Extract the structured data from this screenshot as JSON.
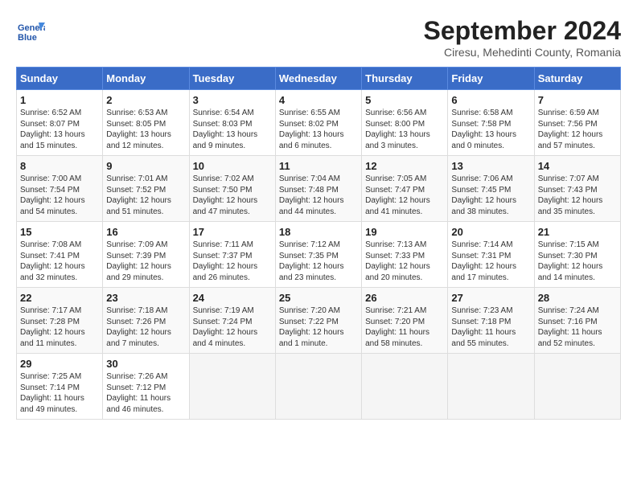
{
  "header": {
    "logo_line1": "General",
    "logo_line2": "Blue",
    "month": "September 2024",
    "location": "Ciresu, Mehedinti County, Romania"
  },
  "weekdays": [
    "Sunday",
    "Monday",
    "Tuesday",
    "Wednesday",
    "Thursday",
    "Friday",
    "Saturday"
  ],
  "weeks": [
    [
      {
        "day": "1",
        "rise": "6:52 AM",
        "set": "8:07 PM",
        "daylight": "13 hours and 15 minutes."
      },
      {
        "day": "2",
        "rise": "6:53 AM",
        "set": "8:05 PM",
        "daylight": "13 hours and 12 minutes."
      },
      {
        "day": "3",
        "rise": "6:54 AM",
        "set": "8:03 PM",
        "daylight": "13 hours and 9 minutes."
      },
      {
        "day": "4",
        "rise": "6:55 AM",
        "set": "8:02 PM",
        "daylight": "13 hours and 6 minutes."
      },
      {
        "day": "5",
        "rise": "6:56 AM",
        "set": "8:00 PM",
        "daylight": "13 hours and 3 minutes."
      },
      {
        "day": "6",
        "rise": "6:58 AM",
        "set": "7:58 PM",
        "daylight": "13 hours and 0 minutes."
      },
      {
        "day": "7",
        "rise": "6:59 AM",
        "set": "7:56 PM",
        "daylight": "12 hours and 57 minutes."
      }
    ],
    [
      {
        "day": "8",
        "rise": "7:00 AM",
        "set": "7:54 PM",
        "daylight": "12 hours and 54 minutes."
      },
      {
        "day": "9",
        "rise": "7:01 AM",
        "set": "7:52 PM",
        "daylight": "12 hours and 51 minutes."
      },
      {
        "day": "10",
        "rise": "7:02 AM",
        "set": "7:50 PM",
        "daylight": "12 hours and 47 minutes."
      },
      {
        "day": "11",
        "rise": "7:04 AM",
        "set": "7:48 PM",
        "daylight": "12 hours and 44 minutes."
      },
      {
        "day": "12",
        "rise": "7:05 AM",
        "set": "7:47 PM",
        "daylight": "12 hours and 41 minutes."
      },
      {
        "day": "13",
        "rise": "7:06 AM",
        "set": "7:45 PM",
        "daylight": "12 hours and 38 minutes."
      },
      {
        "day": "14",
        "rise": "7:07 AM",
        "set": "7:43 PM",
        "daylight": "12 hours and 35 minutes."
      }
    ],
    [
      {
        "day": "15",
        "rise": "7:08 AM",
        "set": "7:41 PM",
        "daylight": "12 hours and 32 minutes."
      },
      {
        "day": "16",
        "rise": "7:09 AM",
        "set": "7:39 PM",
        "daylight": "12 hours and 29 minutes."
      },
      {
        "day": "17",
        "rise": "7:11 AM",
        "set": "7:37 PM",
        "daylight": "12 hours and 26 minutes."
      },
      {
        "day": "18",
        "rise": "7:12 AM",
        "set": "7:35 PM",
        "daylight": "12 hours and 23 minutes."
      },
      {
        "day": "19",
        "rise": "7:13 AM",
        "set": "7:33 PM",
        "daylight": "12 hours and 20 minutes."
      },
      {
        "day": "20",
        "rise": "7:14 AM",
        "set": "7:31 PM",
        "daylight": "12 hours and 17 minutes."
      },
      {
        "day": "21",
        "rise": "7:15 AM",
        "set": "7:30 PM",
        "daylight": "12 hours and 14 minutes."
      }
    ],
    [
      {
        "day": "22",
        "rise": "7:17 AM",
        "set": "7:28 PM",
        "daylight": "12 hours and 11 minutes."
      },
      {
        "day": "23",
        "rise": "7:18 AM",
        "set": "7:26 PM",
        "daylight": "12 hours and 7 minutes."
      },
      {
        "day": "24",
        "rise": "7:19 AM",
        "set": "7:24 PM",
        "daylight": "12 hours and 4 minutes."
      },
      {
        "day": "25",
        "rise": "7:20 AM",
        "set": "7:22 PM",
        "daylight": "12 hours and 1 minute."
      },
      {
        "day": "26",
        "rise": "7:21 AM",
        "set": "7:20 PM",
        "daylight": "11 hours and 58 minutes."
      },
      {
        "day": "27",
        "rise": "7:23 AM",
        "set": "7:18 PM",
        "daylight": "11 hours and 55 minutes."
      },
      {
        "day": "28",
        "rise": "7:24 AM",
        "set": "7:16 PM",
        "daylight": "11 hours and 52 minutes."
      }
    ],
    [
      {
        "day": "29",
        "rise": "7:25 AM",
        "set": "7:14 PM",
        "daylight": "11 hours and 49 minutes."
      },
      {
        "day": "30",
        "rise": "7:26 AM",
        "set": "7:12 PM",
        "daylight": "11 hours and 46 minutes."
      },
      null,
      null,
      null,
      null,
      null
    ]
  ],
  "labels": {
    "sunrise": "Sunrise:",
    "sunset": "Sunset:",
    "daylight": "Daylight:"
  }
}
